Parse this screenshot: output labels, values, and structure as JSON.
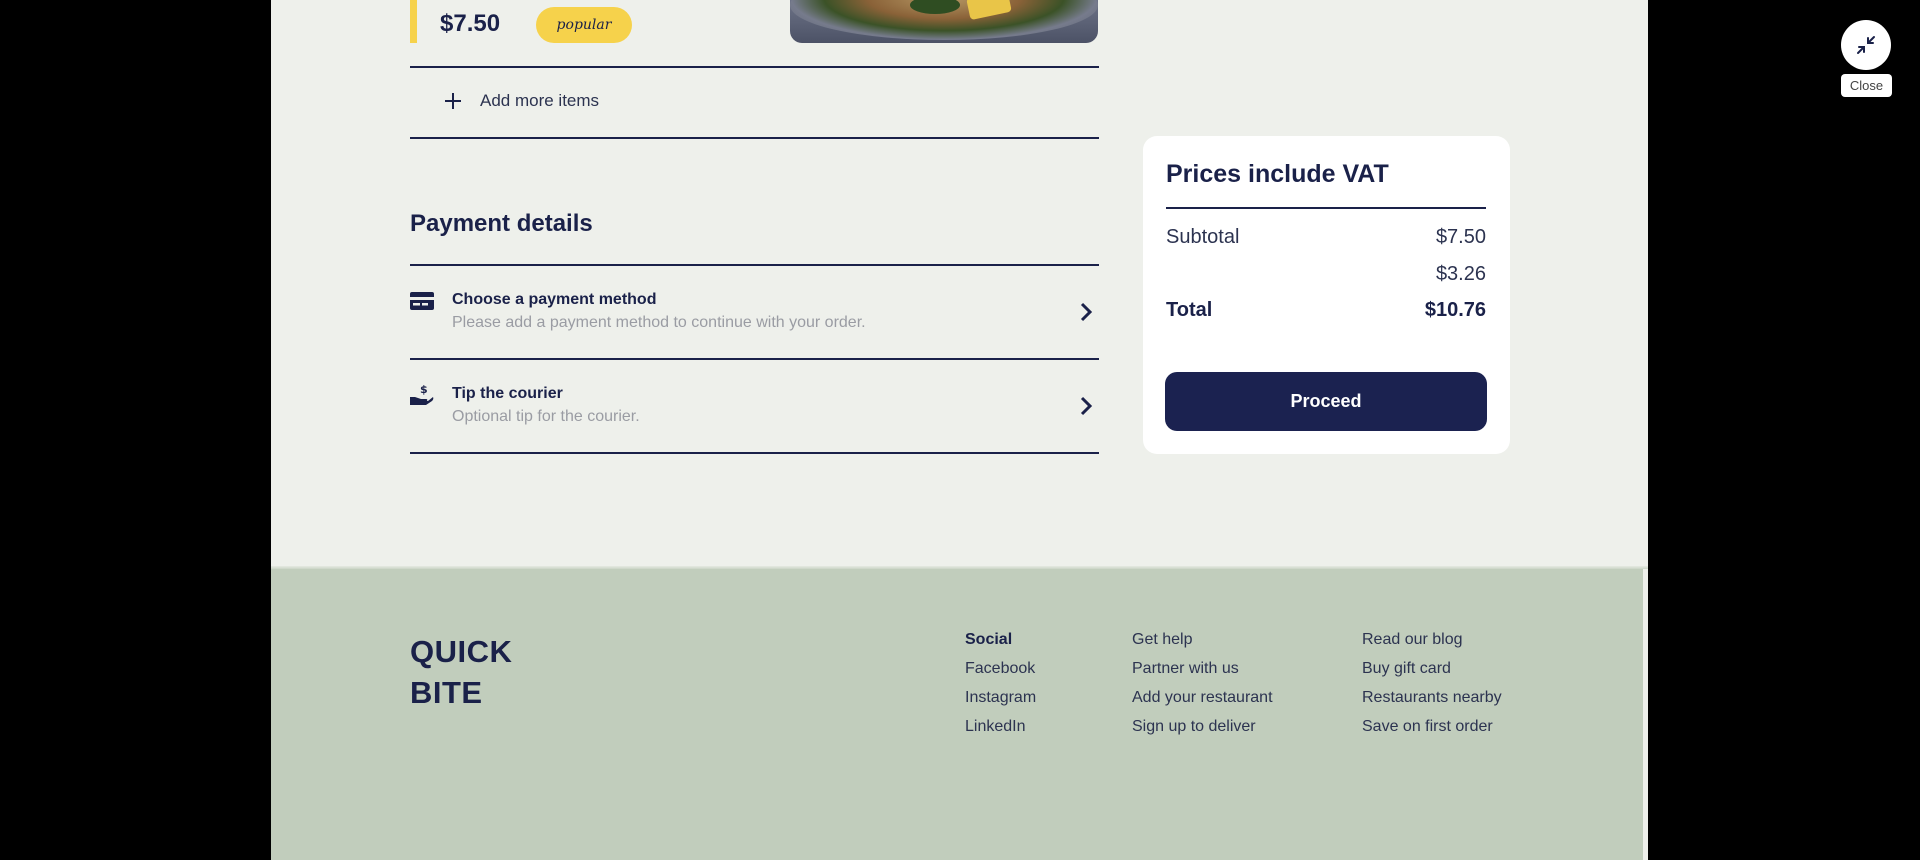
{
  "item": {
    "price": "$7.50",
    "badge": "popular"
  },
  "add_more": {
    "label": "Add more items"
  },
  "payment": {
    "title": "Payment details",
    "rows": [
      {
        "title": "Choose a payment method",
        "subtitle": "Please add a payment method to continue with your order.",
        "icon": "credit-card-icon"
      },
      {
        "title": "Tip the courier",
        "subtitle": "Optional tip for the courier.",
        "icon": "hand-coin-icon"
      }
    ]
  },
  "summary": {
    "heading": "Prices include VAT",
    "subtotal_label": "Subtotal",
    "subtotal_value": "$7.50",
    "fee_value": "$3.26",
    "total_label": "Total",
    "total_value": "$10.76",
    "proceed_label": "Proceed"
  },
  "footer": {
    "logo_line1": "QUICK",
    "logo_line2": "BITE",
    "social": {
      "heading": "Social",
      "links": [
        "Facebook",
        "Instagram",
        "LinkedIn"
      ]
    },
    "col2": [
      "Get help",
      "Partner with us",
      "Add your restaurant",
      "Sign up to deliver"
    ],
    "col3": [
      "Read our blog",
      "Buy gift card",
      "Restaurants nearby",
      "Save on first order"
    ]
  },
  "overlay": {
    "close_label": "Close"
  },
  "colors": {
    "navy": "#1a2149",
    "accent_yellow": "#f6d24b",
    "page_bg": "#eef0eb",
    "footer_bg": "#c1cdbc"
  }
}
